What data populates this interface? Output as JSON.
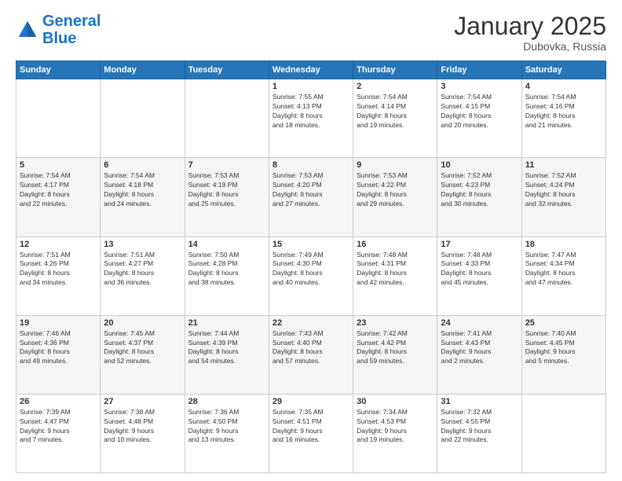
{
  "logo": {
    "line1": "General",
    "line2": "Blue"
  },
  "header": {
    "month": "January 2025",
    "location": "Dubovka, Russia"
  },
  "weekdays": [
    "Sunday",
    "Monday",
    "Tuesday",
    "Wednesday",
    "Thursday",
    "Friday",
    "Saturday"
  ],
  "weeks": [
    [
      {
        "day": "",
        "info": ""
      },
      {
        "day": "",
        "info": ""
      },
      {
        "day": "",
        "info": ""
      },
      {
        "day": "1",
        "info": "Sunrise: 7:55 AM\nSunset: 4:13 PM\nDaylight: 8 hours\nand 18 minutes."
      },
      {
        "day": "2",
        "info": "Sunrise: 7:54 AM\nSunset: 4:14 PM\nDaylight: 8 hours\nand 19 minutes."
      },
      {
        "day": "3",
        "info": "Sunrise: 7:54 AM\nSunset: 4:15 PM\nDaylight: 8 hours\nand 20 minutes."
      },
      {
        "day": "4",
        "info": "Sunrise: 7:54 AM\nSunset: 4:16 PM\nDaylight: 8 hours\nand 21 minutes."
      }
    ],
    [
      {
        "day": "5",
        "info": "Sunrise: 7:54 AM\nSunset: 4:17 PM\nDaylight: 8 hours\nand 22 minutes."
      },
      {
        "day": "6",
        "info": "Sunrise: 7:54 AM\nSunset: 4:18 PM\nDaylight: 8 hours\nand 24 minutes."
      },
      {
        "day": "7",
        "info": "Sunrise: 7:53 AM\nSunset: 4:19 PM\nDaylight: 8 hours\nand 25 minutes."
      },
      {
        "day": "8",
        "info": "Sunrise: 7:53 AM\nSunset: 4:20 PM\nDaylight: 8 hours\nand 27 minutes."
      },
      {
        "day": "9",
        "info": "Sunrise: 7:53 AM\nSunset: 4:22 PM\nDaylight: 8 hours\nand 29 minutes."
      },
      {
        "day": "10",
        "info": "Sunrise: 7:52 AM\nSunset: 4:23 PM\nDaylight: 8 hours\nand 30 minutes."
      },
      {
        "day": "11",
        "info": "Sunrise: 7:52 AM\nSunset: 4:24 PM\nDaylight: 8 hours\nand 32 minutes."
      }
    ],
    [
      {
        "day": "12",
        "info": "Sunrise: 7:51 AM\nSunset: 4:26 PM\nDaylight: 8 hours\nand 34 minutes."
      },
      {
        "day": "13",
        "info": "Sunrise: 7:51 AM\nSunset: 4:27 PM\nDaylight: 8 hours\nand 36 minutes."
      },
      {
        "day": "14",
        "info": "Sunrise: 7:50 AM\nSunset: 4:28 PM\nDaylight: 8 hours\nand 38 minutes."
      },
      {
        "day": "15",
        "info": "Sunrise: 7:49 AM\nSunset: 4:30 PM\nDaylight: 8 hours\nand 40 minutes."
      },
      {
        "day": "16",
        "info": "Sunrise: 7:48 AM\nSunset: 4:31 PM\nDaylight: 8 hours\nand 42 minutes."
      },
      {
        "day": "17",
        "info": "Sunrise: 7:48 AM\nSunset: 4:33 PM\nDaylight: 8 hours\nand 45 minutes."
      },
      {
        "day": "18",
        "info": "Sunrise: 7:47 AM\nSunset: 4:34 PM\nDaylight: 8 hours\nand 47 minutes."
      }
    ],
    [
      {
        "day": "19",
        "info": "Sunrise: 7:46 AM\nSunset: 4:36 PM\nDaylight: 8 hours\nand 49 minutes."
      },
      {
        "day": "20",
        "info": "Sunrise: 7:45 AM\nSunset: 4:37 PM\nDaylight: 8 hours\nand 52 minutes."
      },
      {
        "day": "21",
        "info": "Sunrise: 7:44 AM\nSunset: 4:39 PM\nDaylight: 8 hours\nand 54 minutes."
      },
      {
        "day": "22",
        "info": "Sunrise: 7:43 AM\nSunset: 4:40 PM\nDaylight: 8 hours\nand 57 minutes."
      },
      {
        "day": "23",
        "info": "Sunrise: 7:42 AM\nSunset: 4:42 PM\nDaylight: 8 hours\nand 59 minutes."
      },
      {
        "day": "24",
        "info": "Sunrise: 7:41 AM\nSunset: 4:43 PM\nDaylight: 9 hours\nand 2 minutes."
      },
      {
        "day": "25",
        "info": "Sunrise: 7:40 AM\nSunset: 4:45 PM\nDaylight: 9 hours\nand 5 minutes."
      }
    ],
    [
      {
        "day": "26",
        "info": "Sunrise: 7:39 AM\nSunset: 4:47 PM\nDaylight: 9 hours\nand 7 minutes."
      },
      {
        "day": "27",
        "info": "Sunrise: 7:38 AM\nSunset: 4:48 PM\nDaylight: 9 hours\nand 10 minutes."
      },
      {
        "day": "28",
        "info": "Sunrise: 7:36 AM\nSunset: 4:50 PM\nDaylight: 9 hours\nand 13 minutes."
      },
      {
        "day": "29",
        "info": "Sunrise: 7:35 AM\nSunset: 4:51 PM\nDaylight: 9 hours\nand 16 minutes."
      },
      {
        "day": "30",
        "info": "Sunrise: 7:34 AM\nSunset: 4:53 PM\nDaylight: 9 hours\nand 19 minutes."
      },
      {
        "day": "31",
        "info": "Sunrise: 7:32 AM\nSunset: 4:55 PM\nDaylight: 9 hours\nand 22 minutes."
      },
      {
        "day": "",
        "info": ""
      }
    ]
  ]
}
